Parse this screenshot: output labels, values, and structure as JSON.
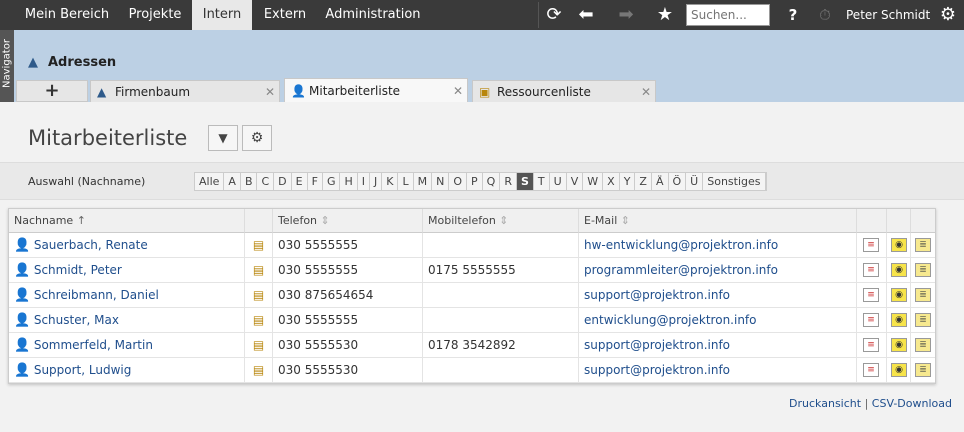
{
  "topnav": {
    "items": [
      "Mein Bereich",
      "Projekte",
      "Intern",
      "Extern",
      "Administration"
    ],
    "active": "Intern",
    "search_placeholder": "Suchen...",
    "help_label": "?",
    "user_name": "Peter Schmidt"
  },
  "navigator_label": "Navigator",
  "header": {
    "section_title": "Adressen",
    "add_tab_label": "+",
    "tabs": [
      {
        "label": "Firmenbaum",
        "icon": "building-icon"
      },
      {
        "label": "Mitarbeiterliste",
        "icon": "person-icon"
      },
      {
        "label": "Ressourcenliste",
        "icon": "resource-icon"
      }
    ],
    "active_tab": "Mitarbeiterliste"
  },
  "page": {
    "title": "Mitarbeiterliste"
  },
  "filter": {
    "label": "Auswahl (Nachname)",
    "letters": [
      "Alle",
      "A",
      "B",
      "C",
      "D",
      "E",
      "F",
      "G",
      "H",
      "I",
      "J",
      "K",
      "L",
      "M",
      "N",
      "O",
      "P",
      "Q",
      "R",
      "S",
      "T",
      "U",
      "V",
      "W",
      "X",
      "Y",
      "Z",
      "Ä",
      "Ö",
      "Ü",
      "Sonstiges"
    ],
    "selected": "S"
  },
  "table": {
    "columns": {
      "name": "Nachname",
      "phone": "Telefon",
      "mobile": "Mobiltelefon",
      "email": "E-Mail"
    },
    "rows": [
      {
        "name": "Sauerbach, Renate",
        "phone": "030 5555555",
        "mobile": "",
        "email": "hw-entwicklung@projektron.info"
      },
      {
        "name": "Schmidt, Peter",
        "phone": "030 5555555",
        "mobile": "0175 5555555",
        "email": "programmleiter@projektron.info"
      },
      {
        "name": "Schreibmann, Daniel",
        "phone": "030 875654654",
        "mobile": "",
        "email": "support@projektron.info"
      },
      {
        "name": "Schuster, Max",
        "phone": "030 5555555",
        "mobile": "",
        "email": "entwicklung@projektron.info"
      },
      {
        "name": "Sommerfeld, Martin",
        "phone": "030 5555530",
        "mobile": "0178 3542892",
        "email": "support@projektron.info"
      },
      {
        "name": "Support, Ludwig",
        "phone": "030 5555530",
        "mobile": "",
        "email": "support@projektron.info"
      }
    ]
  },
  "footer": {
    "print_label": "Druckansicht",
    "separator": "|",
    "csv_label": "CSV-Download"
  }
}
